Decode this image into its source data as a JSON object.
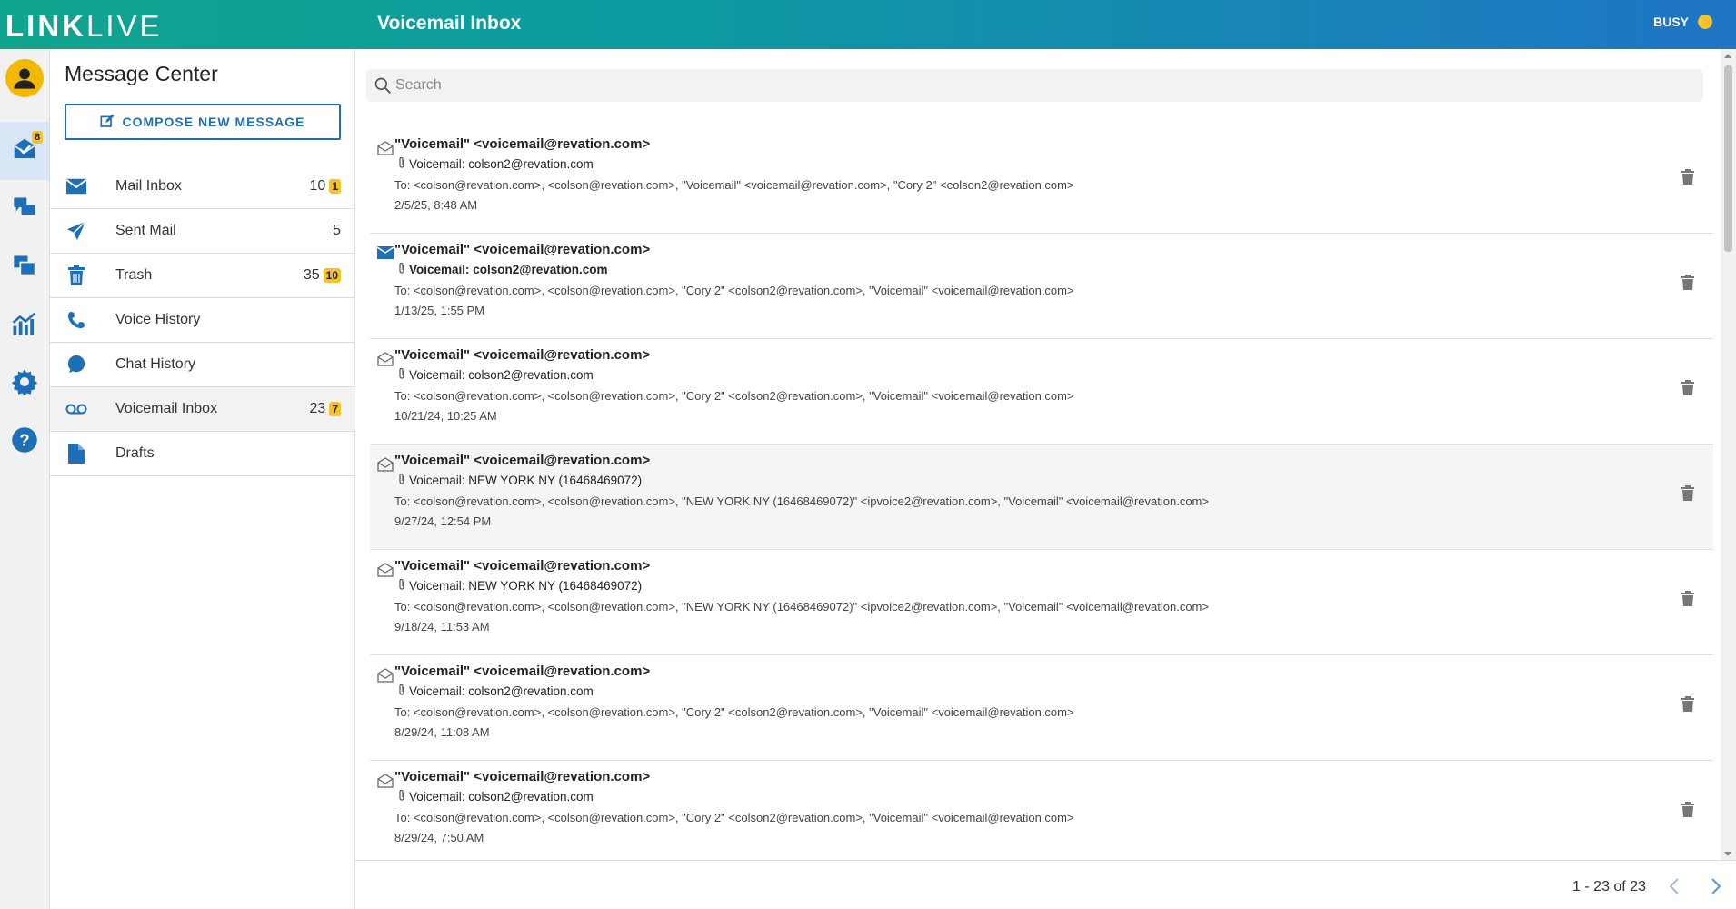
{
  "app": {
    "logo_bold": "LINK",
    "logo_thin": "LIVE",
    "window_title": "Voicemail Inbox",
    "status_label": "BUSY",
    "status_color": "#f5c22b",
    "accent": "#1f6fb8"
  },
  "rail": {
    "messages_badge": "8",
    "icons": [
      "avatar-icon",
      "messages-icon",
      "chat-icon",
      "screen-share-icon",
      "analytics-icon",
      "settings-icon",
      "help-icon"
    ]
  },
  "nav": {
    "title": "Message Center",
    "compose_label": "COMPOSE NEW MESSAGE",
    "items": [
      {
        "label": "Mail Inbox",
        "count": "10",
        "badge": "1",
        "icon": "envelope-icon"
      },
      {
        "label": "Sent Mail",
        "count": "5",
        "badge": "",
        "icon": "send-icon"
      },
      {
        "label": "Trash",
        "count": "35",
        "badge": "10",
        "icon": "trash-icon"
      },
      {
        "label": "Voice History",
        "count": "",
        "badge": "",
        "icon": "phone-icon"
      },
      {
        "label": "Chat History",
        "count": "",
        "badge": "",
        "icon": "chat-bubble-icon"
      },
      {
        "label": "Voicemail Inbox",
        "count": "23",
        "badge": "7",
        "icon": "voicemail-icon"
      },
      {
        "label": "Drafts",
        "count": "",
        "badge": "",
        "icon": "document-icon"
      }
    ]
  },
  "search": {
    "placeholder": "Search"
  },
  "messages": [
    {
      "from": "\"Voicemail\" <voicemail@revation.com>",
      "subject": "Voicemail: colson2@revation.com",
      "to": "To: <colson@revation.com>, <colson@revation.com>, \"Voicemail\" <voicemail@revation.com>, \"Cory 2\" <colson2@revation.com>",
      "date": "2/5/25, 8:48 AM",
      "unread": false
    },
    {
      "from": "\"Voicemail\" <voicemail@revation.com>",
      "subject": "Voicemail: colson2@revation.com",
      "to": "To: <colson@revation.com>, <colson@revation.com>, \"Cory 2\" <colson2@revation.com>, \"Voicemail\" <voicemail@revation.com>",
      "date": "1/13/25, 1:55 PM",
      "unread": true
    },
    {
      "from": "\"Voicemail\" <voicemail@revation.com>",
      "subject": "Voicemail: colson2@revation.com",
      "to": "To: <colson@revation.com>, <colson@revation.com>, \"Cory 2\" <colson2@revation.com>, \"Voicemail\" <voicemail@revation.com>",
      "date": "10/21/24, 10:25 AM",
      "unread": false
    },
    {
      "from": "\"Voicemail\" <voicemail@revation.com>",
      "subject": "Voicemail: NEW YORK NY (16468469072)",
      "to": "To: <colson@revation.com>, <colson@revation.com>, \"NEW YORK NY (16468469072)\" <ipvoice2@revation.com>, \"Voicemail\" <voicemail@revation.com>",
      "date": "9/27/24, 12:54 PM",
      "unread": false
    },
    {
      "from": "\"Voicemail\" <voicemail@revation.com>",
      "subject": "Voicemail: NEW YORK NY (16468469072)",
      "to": "To: <colson@revation.com>, <colson@revation.com>, \"NEW YORK NY (16468469072)\" <ipvoice2@revation.com>, \"Voicemail\" <voicemail@revation.com>",
      "date": "9/18/24, 11:53 AM",
      "unread": false
    },
    {
      "from": "\"Voicemail\" <voicemail@revation.com>",
      "subject": "Voicemail: colson2@revation.com",
      "to": "To: <colson@revation.com>, <colson@revation.com>, \"Cory 2\" <colson2@revation.com>, \"Voicemail\" <voicemail@revation.com>",
      "date": "8/29/24, 11:08 AM",
      "unread": false
    },
    {
      "from": "\"Voicemail\" <voicemail@revation.com>",
      "subject": "Voicemail: colson2@revation.com",
      "to": "To: <colson@revation.com>, <colson@revation.com>, \"Cory 2\" <colson2@revation.com>, \"Voicemail\" <voicemail@revation.com>",
      "date": "8/29/24, 7:50 AM",
      "unread": false
    }
  ],
  "pagination": {
    "range": "1 - 23 of 23"
  }
}
